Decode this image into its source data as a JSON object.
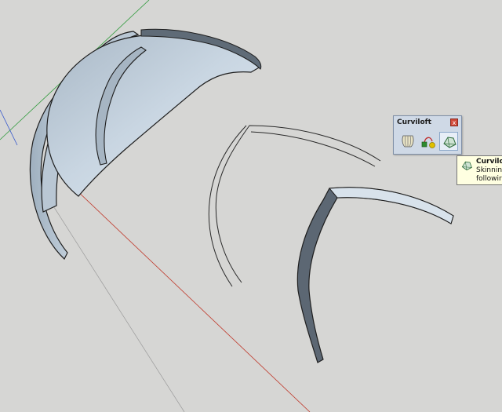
{
  "toolbar": {
    "title": "Curviloft",
    "close_label": "x",
    "buttons": [
      {
        "icon": "loft-by-spline-icon"
      },
      {
        "icon": "skinning-path-icon"
      },
      {
        "icon": "skinning-contours-icon"
      }
    ]
  },
  "tooltip": {
    "title": "Curvilof",
    "line1": "Skinnin",
    "line2": "followir"
  },
  "colors": {
    "background": "#d6d6d4",
    "surface_light": "#d9e4ee",
    "surface_dark": "#6d7b88",
    "axis_red": "#c0392b",
    "axis_green": "#2e9a3a",
    "axis_blue": "#3355cc"
  }
}
